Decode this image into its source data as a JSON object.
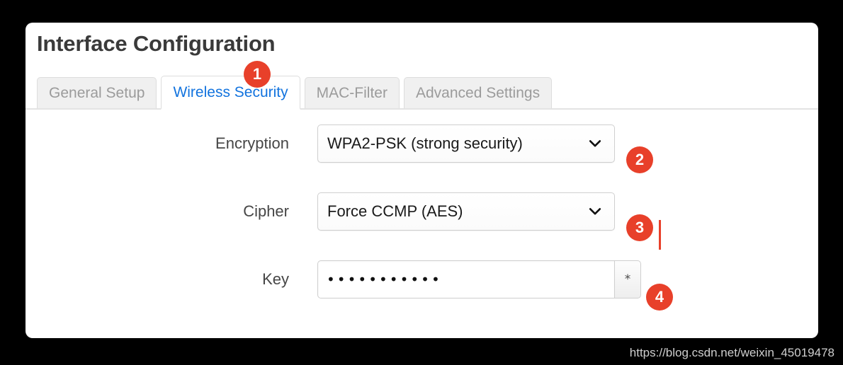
{
  "page": {
    "background_color": "#000000",
    "card_background": "#ffffff",
    "accent_color": "#e8402a",
    "active_tab_color": "#1273de",
    "watermark": "https://blog.csdn.net/weixin_45019478"
  },
  "card": {
    "title": "Interface Configuration"
  },
  "tabs": [
    {
      "label": "General Setup",
      "active": false
    },
    {
      "label": "Wireless Security",
      "active": true
    },
    {
      "label": "MAC-Filter",
      "active": false
    },
    {
      "label": "Advanced Settings",
      "active": false
    }
  ],
  "form": {
    "encryption": {
      "label": "Encryption",
      "value": "WPA2-PSK (strong security)",
      "icon": "chevron-down-icon"
    },
    "cipher": {
      "label": "Cipher",
      "value": "Force CCMP (AES)",
      "icon": "chevron-down-icon"
    },
    "key": {
      "label": "Key",
      "value": "•••••••••••",
      "toggle_label": "*"
    }
  },
  "badges": [
    {
      "id": "1",
      "label": "1"
    },
    {
      "id": "2",
      "label": "2"
    },
    {
      "id": "3",
      "label": "3"
    },
    {
      "id": "4",
      "label": "4"
    }
  ]
}
